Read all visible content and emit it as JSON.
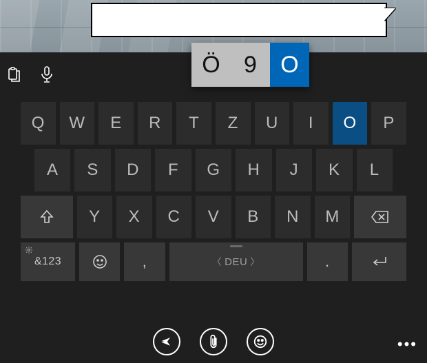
{
  "bubble": {
    "text": ""
  },
  "popup": {
    "options": [
      "Ö",
      "9",
      "O"
    ],
    "selected_index": 2
  },
  "keyboard": {
    "row1": [
      "Q",
      "W",
      "E",
      "R",
      "T",
      "Z",
      "U",
      "I",
      "O",
      "P"
    ],
    "row2": [
      "A",
      "S",
      "D",
      "F",
      "G",
      "H",
      "J",
      "K",
      "L"
    ],
    "row3_mid": [
      "Y",
      "X",
      "C",
      "V",
      "B",
      "N",
      "M"
    ],
    "sym_label": "&123",
    "comma": ",",
    "dot": ".",
    "space_lang": "DEU",
    "pressed_key": "O"
  },
  "icons": {
    "clipboard": "clipboard-icon",
    "mic": "mic-icon",
    "shift": "shift-icon",
    "backspace": "backspace-icon",
    "emoji": "emoji-icon",
    "enter": "enter-icon",
    "gear": "gear-icon",
    "send": "send-icon",
    "attach": "attach-icon",
    "face": "face-icon",
    "more": "more-icon"
  },
  "colors": {
    "accent": "#0067b8",
    "panel": "#1f1f1f",
    "key": "#2c2c2c",
    "fnkey": "#383838"
  }
}
